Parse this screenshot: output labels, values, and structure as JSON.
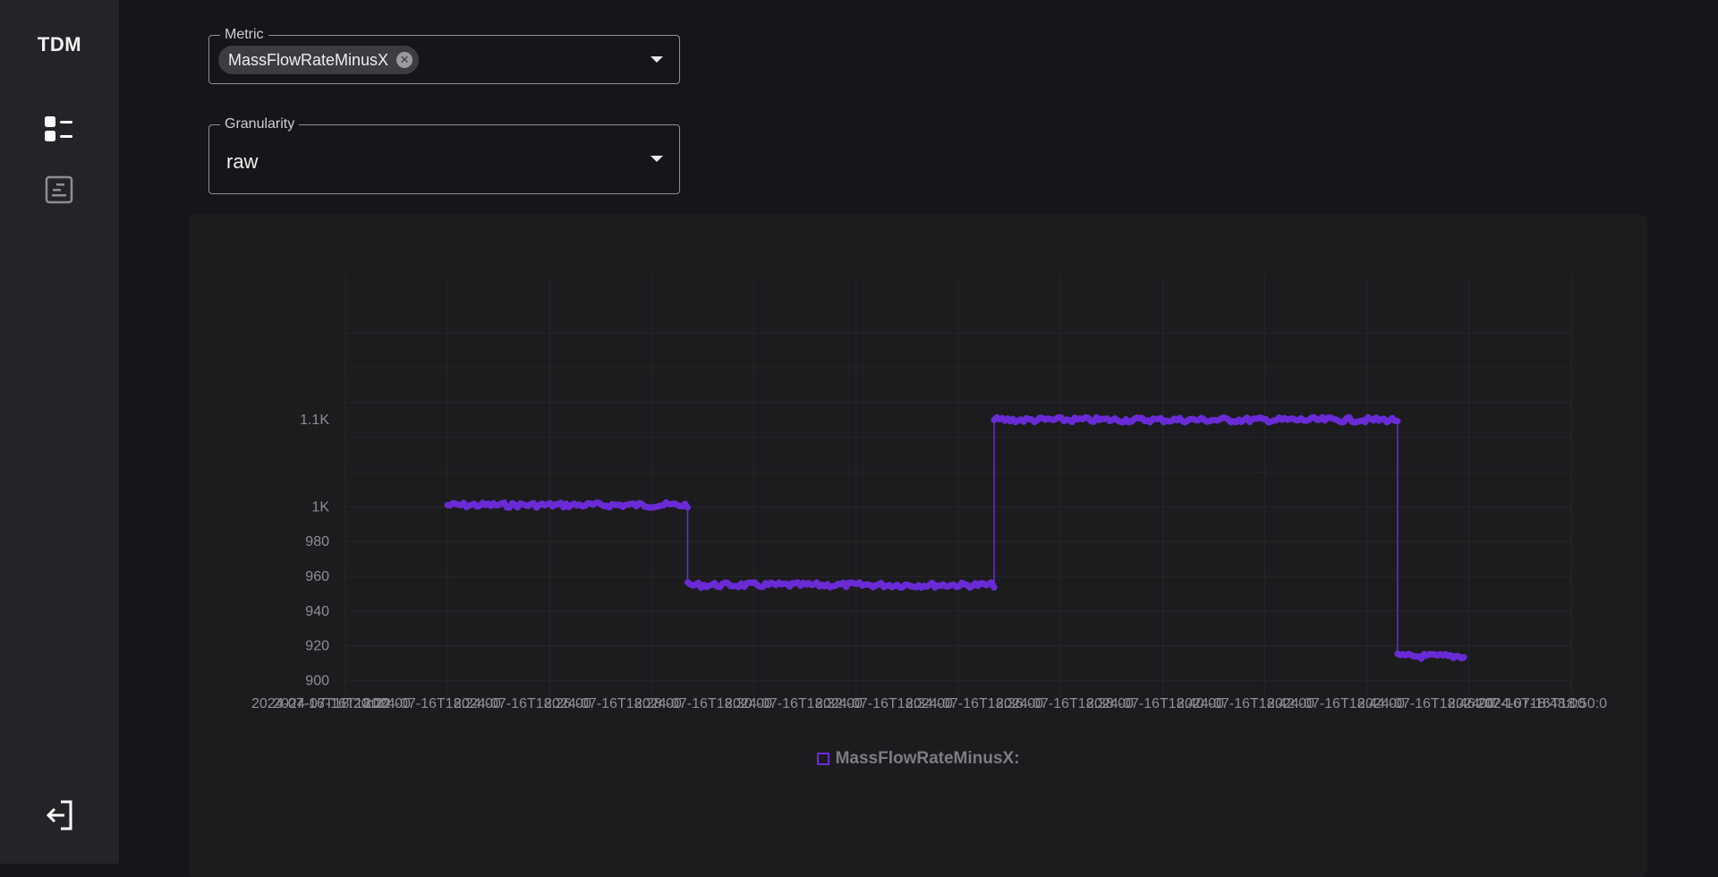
{
  "app": {
    "title": "TDM"
  },
  "nav": {
    "items": [
      {
        "icon": "list-dashboard-icon"
      },
      {
        "icon": "report-document-icon"
      }
    ],
    "logout_icon": "logout-icon"
  },
  "metric": {
    "label": "Metric",
    "selected": [
      "MassFlowRateMinusX"
    ]
  },
  "granularity": {
    "label": "Granularity",
    "value": "raw"
  },
  "colors": {
    "series": "#6a2bd6",
    "background": "#16161a",
    "sidebar": "#242428"
  },
  "chart_data": {
    "type": "line",
    "title": "",
    "xlabel": "",
    "ylabel": "",
    "y_ticks": [
      "900",
      "920",
      "940",
      "960",
      "980",
      "1K",
      "1.1K"
    ],
    "x_tick_labels": [
      "2024-07-16T18:20:00",
      "2024-07-16T18:22:00",
      "2024-07-16T18:24:00",
      "2024-07-16T18:26:00",
      "2024-07-16T18:28:00",
      "2024-07-16T18:30:00",
      "2024-07-16T18:32:00",
      "2024-07-16T18:34:00",
      "2024-07-16T18:36:00",
      "2024-07-16T18:38:00",
      "2024-07-16T18:40:00",
      "2024-07-16T18:42:00",
      "2024-07-16T18:44:00",
      "2024-07-16T18:46:00",
      "2024-07-16T18:48:00",
      "2024-07-16T18:50:0"
    ],
    "series": [
      {
        "name": "MassFlowRateMinusX:",
        "segments": [
          {
            "x_start": 2.0,
            "x_end": 6.7,
            "y": 1001
          },
          {
            "x_start": 6.7,
            "x_end": 12.7,
            "y": 955
          },
          {
            "x_start": 12.7,
            "x_end": 20.6,
            "y": 1050
          },
          {
            "x_start": 20.6,
            "x_end": 21.9,
            "y": 914
          }
        ]
      }
    ],
    "grid": true,
    "legend_position": "bottom"
  }
}
